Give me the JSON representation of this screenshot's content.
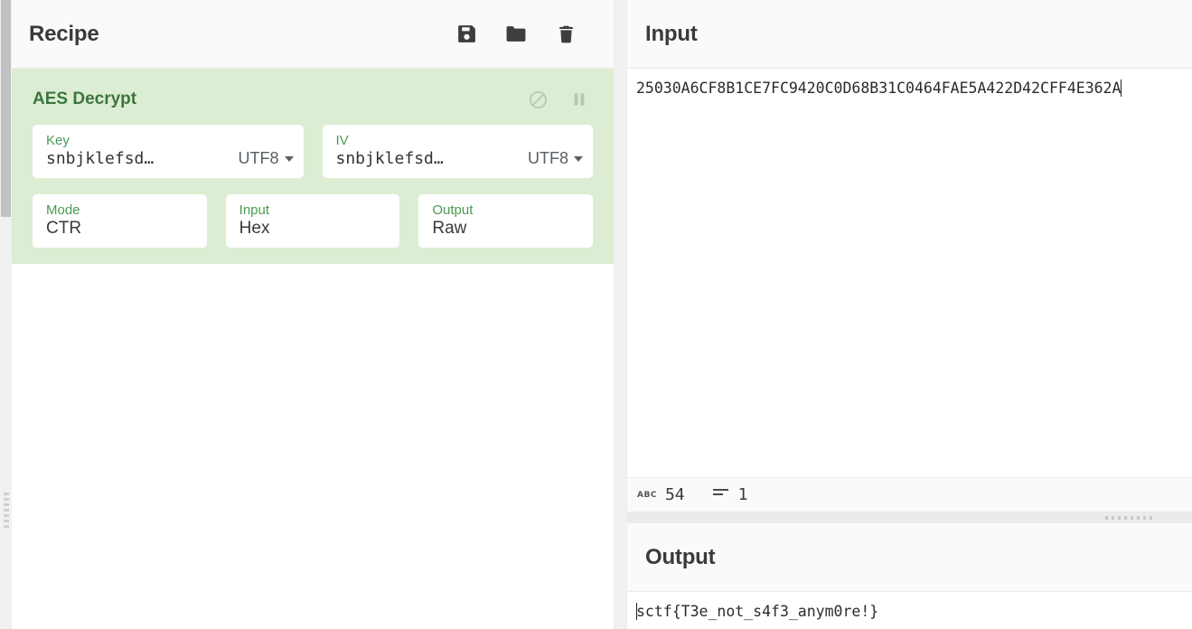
{
  "recipe": {
    "title": "Recipe",
    "toolbar": [
      {
        "name": "save-recipe-button",
        "icon": "floppy-disk-icon",
        "label": "Save"
      },
      {
        "name": "load-recipe-button",
        "icon": "folder-icon",
        "label": "Load"
      },
      {
        "name": "clear-recipe-button",
        "icon": "trash-icon",
        "label": "Clear recipe"
      }
    ],
    "operations": [
      {
        "name": "AES Decrypt",
        "header_icons": [
          {
            "name": "disable-operation-icon",
            "glyph": "circle-slash"
          },
          {
            "name": "pause-operation-icon",
            "glyph": "pause"
          }
        ],
        "args_row_1": [
          {
            "label": "Key",
            "value": "snbjklefsd…",
            "encoding": "UTF8"
          },
          {
            "label": "IV",
            "value": "snbjklefsd…",
            "encoding": "UTF8"
          }
        ],
        "args_row_2": [
          {
            "label": "Mode",
            "value": "CTR"
          },
          {
            "label": "Input",
            "value": "Hex"
          },
          {
            "label": "Output",
            "value": "Raw"
          }
        ]
      }
    ]
  },
  "input": {
    "title": "Input",
    "value": "25030A6CF8B1CE7FC9420C0D68B31C0464FAE5A422D42CFF4E362A",
    "status": {
      "chars_icon_label": "ABC",
      "chars": "54",
      "lines_icon": "lines-icon",
      "lines": "1"
    }
  },
  "output": {
    "title": "Output",
    "value": "sctf{T3e_not_s4f3_anym0re!}"
  },
  "colors": {
    "operation_bg": "#dcedd3",
    "operation_title": "#3c763d",
    "arg_label": "#4a9a52",
    "panel_header_bg": "#fafafa",
    "text": "#3a3a3a"
  }
}
